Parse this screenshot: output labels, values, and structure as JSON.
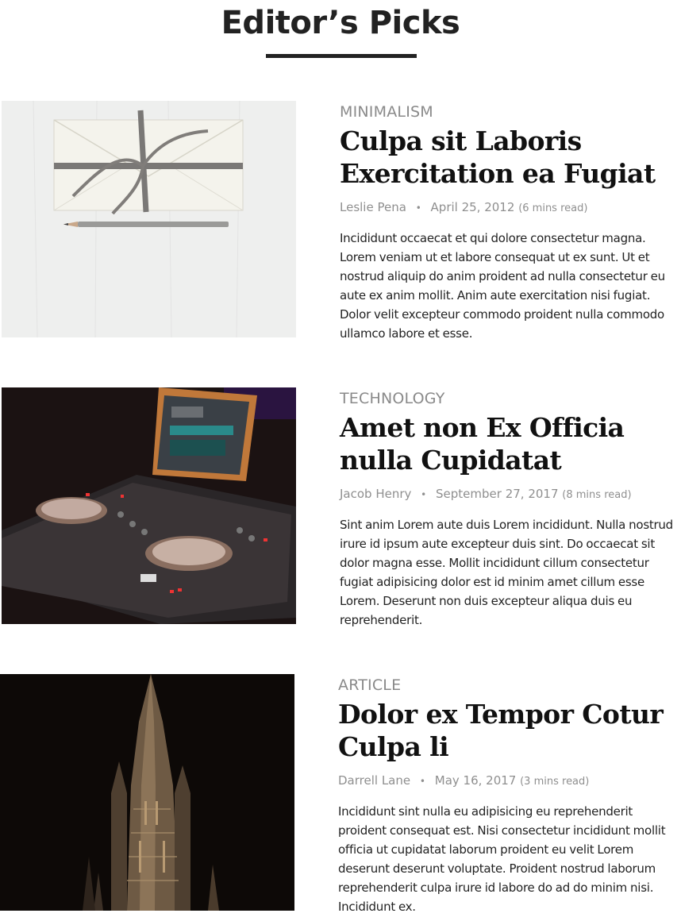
{
  "header": {
    "title": "Editor’s Picks"
  },
  "articles": [
    {
      "category": "MINIMALISM",
      "title": "Culpa sit Laboris Exercitation ea Fugiat",
      "author": "Leslie Pena",
      "date": "April 25, 2012",
      "read_time": "(6 mins read)",
      "excerpt": "Incididunt occaecat et qui dolore consectetur magna. Lorem veniam ut et labore consequat ut ex sunt. Ut et nostrud aliquip do anim proident ad nulla consectetur eu aute ex anim mollit. Anim aute exercitation nisi fugiat. Dolor velit excepteur commodo proident nulla commodo ullamco labore et esse."
    },
    {
      "category": "TECHNOLOGY",
      "title": "Amet non Ex Officia nulla Cupidatat",
      "author": "Jacob Henry",
      "date": "September 27, 2017",
      "read_time": "(8 mins read)",
      "excerpt": "Sint anim Lorem aute duis Lorem incididunt. Nulla nostrud irure id ipsum aute excepteur duis sint. Do occaecat sit dolor magna esse. Mollit incididunt cillum consectetur fugiat adipisicing dolor est id minim amet cillum esse Lorem. Deserunt non duis excepteur aliqua duis eu reprehenderit."
    },
    {
      "category": "ARTICLE",
      "title": "Dolor ex Tempor Cotur Culpa li",
      "author": "Darrell Lane",
      "date": "May 16, 2017",
      "read_time": "(3 mins read)",
      "excerpt": "Incididunt sint nulla eu adipisicing eu reprehenderit proident consequat est. Nisi consectetur incididunt mollit officia ut cupidatat laborum proident eu velit Lorem deserunt deserunt voluptate. Proident nostrud laborum reprehenderit culpa irure id labore do ad do minim nisi. Incididunt ex."
    }
  ],
  "meta_separator": "•"
}
